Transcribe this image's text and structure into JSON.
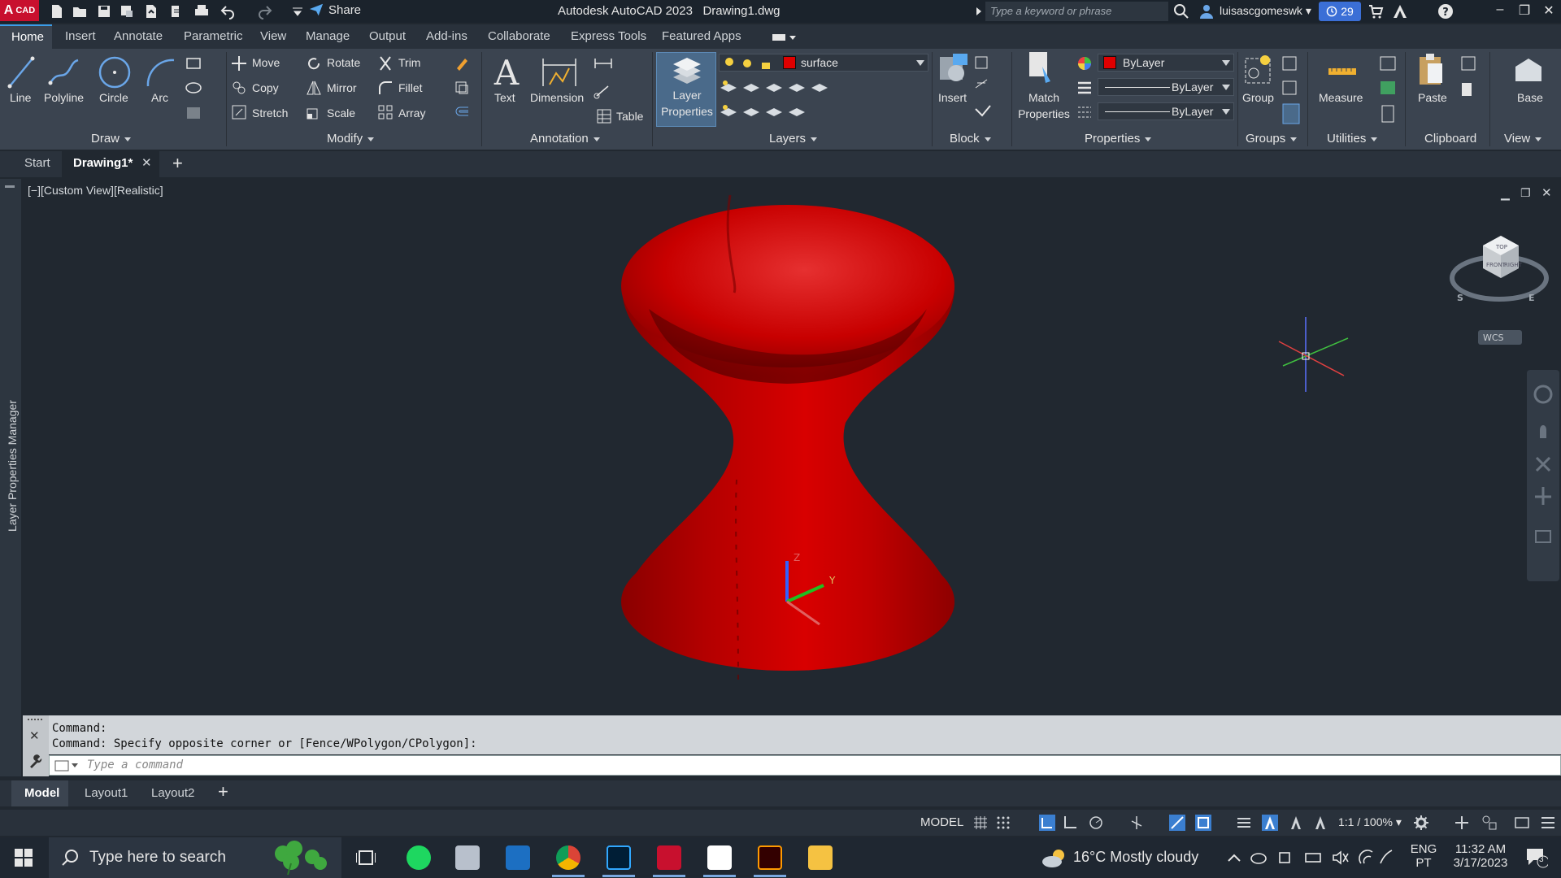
{
  "titlebar": {
    "logo_text": "A",
    "logo_sub": "CAD",
    "share_label": "Share",
    "app_title": "Autodesk AutoCAD 2023",
    "file_title": "Drawing1.dwg",
    "search_placeholder": "Type a keyword or phrase",
    "user": "luisascgomeswk",
    "badge_count": "29"
  },
  "ribbon_tabs": [
    "Home",
    "Insert",
    "Annotate",
    "Parametric",
    "View",
    "Manage",
    "Output",
    "Add-ins",
    "Collaborate",
    "Express Tools",
    "Featured Apps"
  ],
  "ribbon": {
    "draw": {
      "title": "Draw",
      "line": "Line",
      "polyline": "Polyline",
      "circle": "Circle",
      "arc": "Arc"
    },
    "modify": {
      "title": "Modify",
      "move": "Move",
      "rotate": "Rotate",
      "trim": "Trim",
      "copy": "Copy",
      "mirror": "Mirror",
      "fillet": "Fillet",
      "stretch": "Stretch",
      "scale": "Scale",
      "array": "Array"
    },
    "annotation": {
      "title": "Annotation",
      "text": "Text",
      "dimension": "Dimension",
      "table": "Table"
    },
    "layers": {
      "title": "Layers",
      "layer_properties_1": "Layer",
      "layer_properties_2": "Properties",
      "current_layer": "surface"
    },
    "block": {
      "title": "Block",
      "insert": "Insert"
    },
    "properties": {
      "title": "Properties",
      "match_1": "Match",
      "match_2": "Properties",
      "color": "ByLayer",
      "linetype": "ByLayer",
      "lineweight": "ByLayer"
    },
    "groups": {
      "title": "Groups",
      "group": "Group"
    },
    "utilities": {
      "title": "Utilities",
      "measure": "Measure"
    },
    "clipboard": {
      "title": "Clipboard",
      "paste": "Paste"
    },
    "view": {
      "title": "View",
      "base": "Base"
    }
  },
  "file_tabs": {
    "start": "Start",
    "drawing": "Drawing1*"
  },
  "viewport": {
    "view_label": "[−][Custom View][Realistic]",
    "palette_label": "Layer Properties Manager",
    "wcs_label": "WCS",
    "viewcube": {
      "top": "TOP",
      "front": "FRONT",
      "right": "RIGHT",
      "s": "S",
      "e": "E"
    },
    "ucs": {
      "z": "Z",
      "y": "Y"
    }
  },
  "command": {
    "line1": "Command:",
    "line2": "Command: Specify opposite corner or [Fence/WPolygon/CPolygon]:",
    "placeholder": "Type a command"
  },
  "layout_tabs": [
    "Model",
    "Layout1",
    "Layout2"
  ],
  "statusbar": {
    "model": "MODEL",
    "scale": "1:1 / 100%"
  },
  "taskbar": {
    "search": "Type here to search",
    "weather": "16°C  Mostly cloudy",
    "lang_1": "ENG",
    "lang_2": "PT",
    "time": "11:32 AM",
    "date": "3/17/2023",
    "notif_count": "3"
  },
  "colors": {
    "accent": "#3b9de8",
    "surface": "#e00000",
    "badge": "#3b6fd6"
  }
}
